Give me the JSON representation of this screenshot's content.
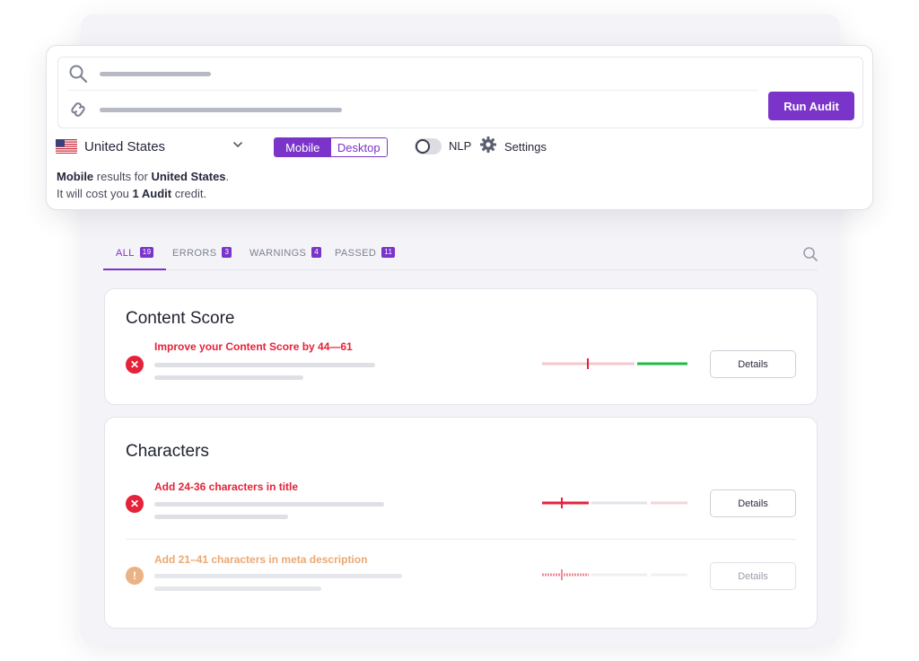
{
  "audit": {
    "run_label": "Run Audit",
    "country": "United States",
    "device_modes": [
      "Mobile",
      "Desktop"
    ],
    "selected_device": "Mobile",
    "nlp_label": "NLP",
    "nlp_enabled": false,
    "settings_label": "Settings",
    "info": {
      "device": "Mobile",
      "mid": " results for ",
      "country": "United States",
      "end": ".",
      "line2_a": "It will cost you ",
      "credit": "1 Audit",
      "line2_b": " credit."
    }
  },
  "tabs": [
    {
      "label": "ALL",
      "count": "19",
      "active": true
    },
    {
      "label": "ERRORS",
      "count": "3",
      "active": false
    },
    {
      "label": "WARNINGS",
      "count": "4",
      "active": false
    },
    {
      "label": "PASSED",
      "count": "11",
      "active": false
    }
  ],
  "sections": [
    {
      "title": "Content Score",
      "issues": [
        {
          "text": "Improve your Content Score by 44—61",
          "status": "error",
          "details": "Details"
        }
      ]
    },
    {
      "title": "Characters",
      "issues": [
        {
          "text": "Add 24-36 characters in title",
          "status": "error",
          "details": "Details"
        },
        {
          "text": "Add 21–41 characters in meta description",
          "status": "warning",
          "details": "Details"
        }
      ]
    }
  ],
  "colors": {
    "accent": "#7b34c9",
    "error": "#e5223a",
    "warning": "#e8a36a",
    "success": "#22bb44"
  },
  "icons": [
    "search-icon",
    "link-icon",
    "us-flag-icon",
    "chevron-down-icon",
    "gear-icon",
    "error-icon",
    "warning-icon"
  ]
}
